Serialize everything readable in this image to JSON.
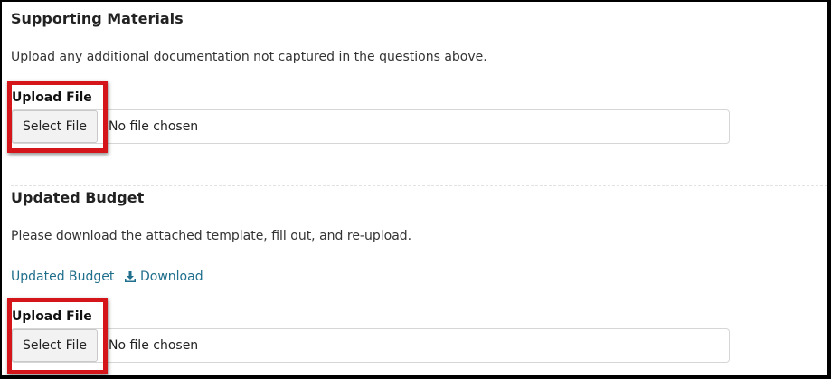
{
  "supporting": {
    "title": "Supporting Materials",
    "description": "Upload any additional documentation not captured in the questions above.",
    "upload_label": "Upload File",
    "button_label": "Select File",
    "file_status": "No file chosen"
  },
  "budget": {
    "title": "Updated Budget",
    "description": "Please download the attached template, fill out, and re-upload.",
    "link_label": "Updated Budget",
    "download_label": "Download",
    "upload_label": "Upload File",
    "button_label": "Select File",
    "file_status": "No file chosen"
  },
  "colors": {
    "highlight": "#d4161b",
    "link": "#1f6e8c"
  }
}
